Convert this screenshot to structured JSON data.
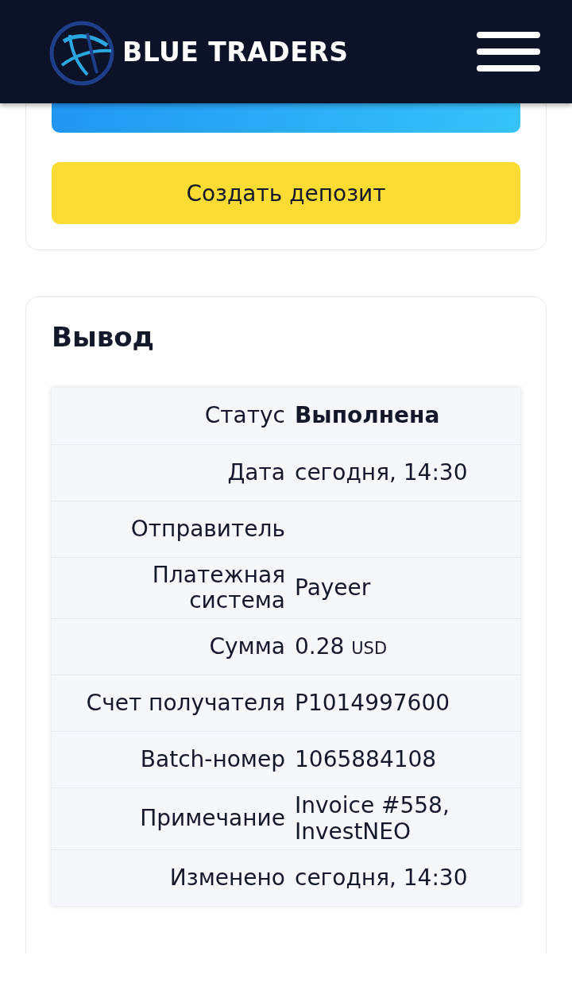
{
  "header": {
    "logo_text": "BLUE TRADERS"
  },
  "actions": {
    "deposit_button": "Создать депозит"
  },
  "withdrawal": {
    "title": "Вывод",
    "status_row": {
      "label": "Статус",
      "value": "Выполнена"
    },
    "rows": [
      {
        "label": "Дата",
        "value": "сегодня, 14:30"
      },
      {
        "label": "Отправитель"
      },
      {
        "label": "Платежная система",
        "value": "Payeer"
      },
      {
        "label": "Сумма",
        "value": "0.28",
        "currency": "USD"
      },
      {
        "label": "Счет получателя",
        "value": "P1014997600"
      },
      {
        "label": "Batch-номер",
        "value": "1065884108"
      },
      {
        "label": "Примечание",
        "value": "Invoice #558, InvestNEO"
      },
      {
        "label": "Изменено",
        "value": "сегодня, 14:30"
      }
    ]
  }
}
